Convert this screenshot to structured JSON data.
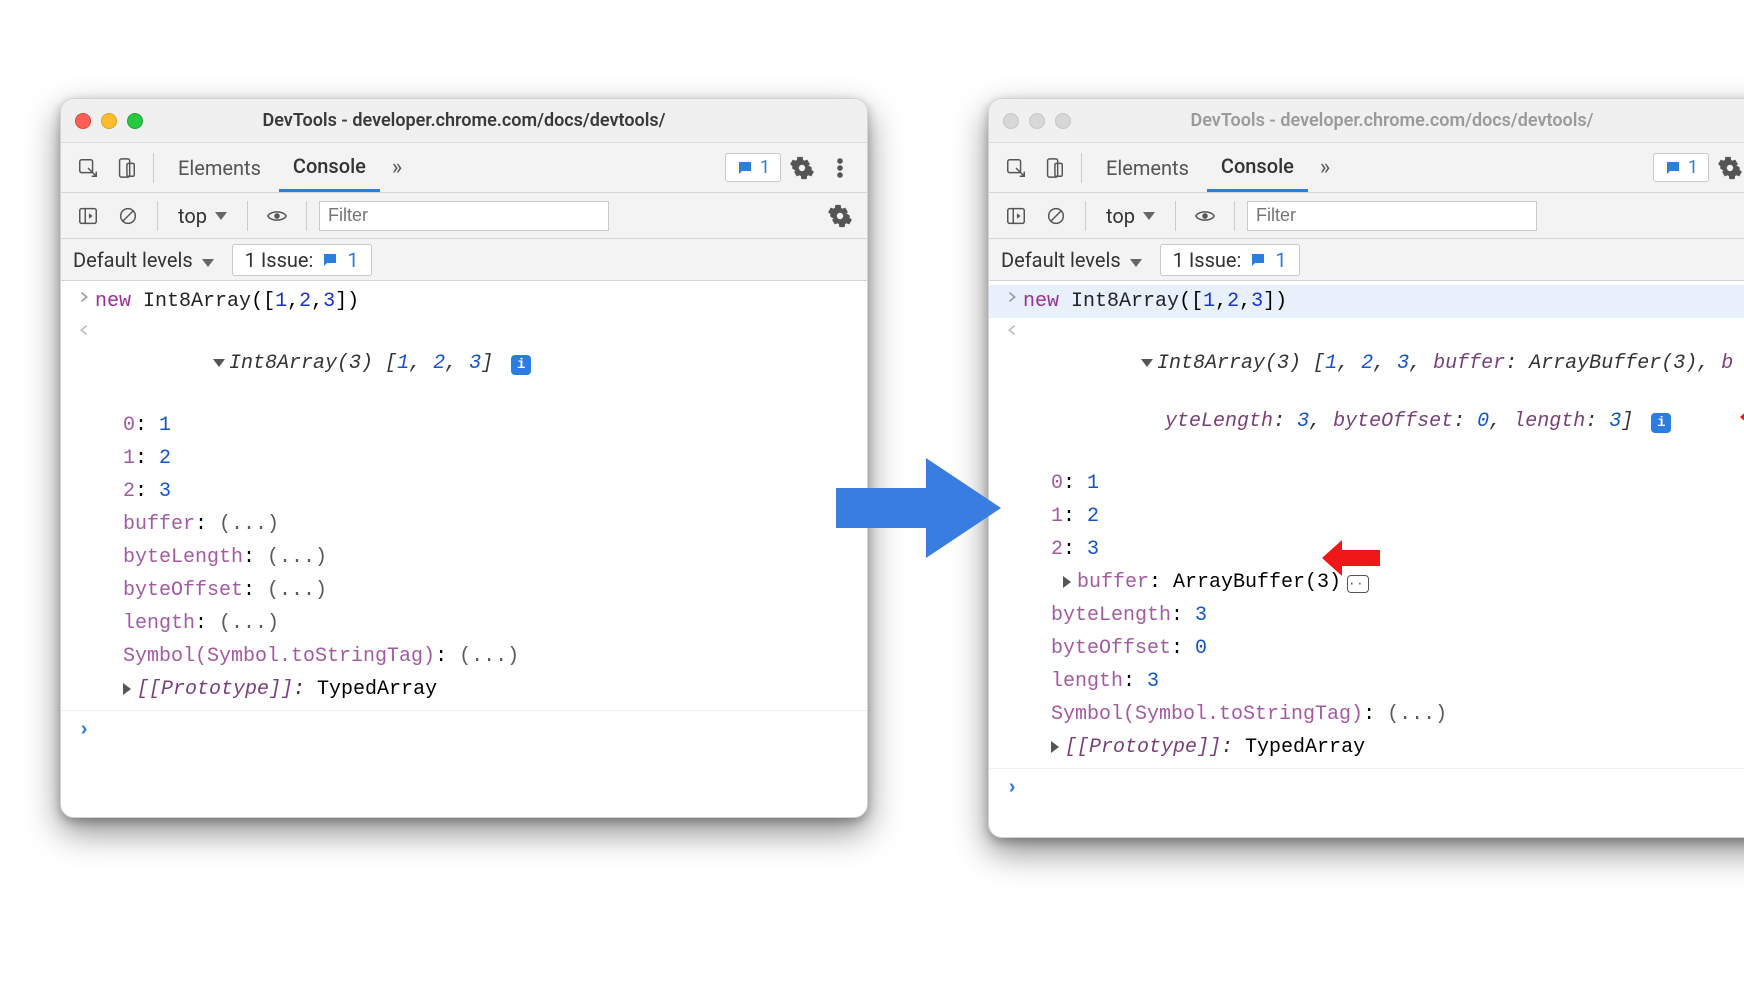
{
  "panelA": {
    "active": true,
    "title": "DevTools - developer.chrome.com/docs/devtools/",
    "tabs": {
      "elements": "Elements",
      "console": "Console"
    },
    "issueCount": "1",
    "context": "top",
    "filterPlaceholder": "Filter",
    "levels": "Default levels",
    "issuesLabel": "1 Issue:",
    "issuesNum": "1",
    "input": "new Int8Array([1,2,3])",
    "preview_head": "Int8Array(3) ",
    "preview_vals": "[1, 2, 3]",
    "props": [
      {
        "k": "0",
        "v": "1",
        "vnum": true
      },
      {
        "k": "1",
        "v": "2",
        "vnum": true
      },
      {
        "k": "2",
        "v": "3",
        "vnum": true
      },
      {
        "k": "buffer",
        "v": "(...)"
      },
      {
        "k": "byteLength",
        "v": "(...)"
      },
      {
        "k": "byteOffset",
        "v": "(...)"
      },
      {
        "k": "length",
        "v": "(...)"
      },
      {
        "k": "Symbol(Symbol.toStringTag)",
        "v": "(...)"
      }
    ],
    "proto": "[[Prototype]]",
    "protoVal": "TypedArray"
  },
  "panelB": {
    "active": false,
    "title": "DevTools - developer.chrome.com/docs/devtools/",
    "tabs": {
      "elements": "Elements",
      "console": "Console"
    },
    "issueCount": "1",
    "context": "top",
    "filterPlaceholder": "Filter",
    "levels": "Default levels",
    "issuesLabel": "1 Issue:",
    "issuesNum": "1",
    "input": "new Int8Array([1,2,3])",
    "preview_line1a": "Int8Array(3) [",
    "preview_line1b": "1, 2, 3, ",
    "preview_line1c": "buffer: ArrayBuffer(3), b",
    "preview_line2": "yteLength: 3, byteOffset: 0, length: 3]",
    "rows": [
      {
        "type": "kv",
        "k": "0",
        "v": "1",
        "vnum": true
      },
      {
        "type": "kv",
        "k": "1",
        "v": "2",
        "vnum": true
      },
      {
        "type": "kv",
        "k": "2",
        "v": "3",
        "vnum": true
      },
      {
        "type": "buffer",
        "k": "buffer",
        "v": "ArrayBuffer(3)"
      },
      {
        "type": "kv",
        "k": "byteLength",
        "v": "3",
        "vnum": true
      },
      {
        "type": "kv",
        "k": "byteOffset",
        "v": "0",
        "vnum": true
      },
      {
        "type": "kv",
        "k": "length",
        "v": "3",
        "vnum": true
      },
      {
        "type": "kv",
        "k": "Symbol(Symbol.toStringTag)",
        "v": "(...)"
      }
    ],
    "proto": "[[Prototype]]",
    "protoVal": "TypedArray"
  }
}
